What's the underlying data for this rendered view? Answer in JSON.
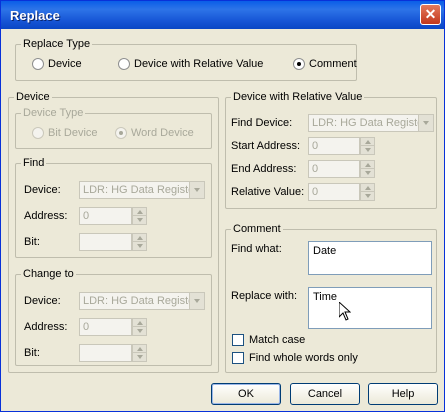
{
  "window": {
    "title": "Replace",
    "close_glyph": "✕"
  },
  "replace_type": {
    "legend": "Replace Type",
    "options": [
      {
        "label": "Device",
        "selected": false
      },
      {
        "label": "Device with Relative Value",
        "selected": false
      },
      {
        "label": "Comment",
        "selected": true
      }
    ]
  },
  "device": {
    "legend": "Device",
    "device_type": {
      "legend": "Device Type",
      "options": [
        {
          "label": "Bit Device",
          "selected": false
        },
        {
          "label": "Word Device",
          "selected": true
        }
      ]
    },
    "find": {
      "legend": "Find",
      "device_label": "Device:",
      "device_value": "LDR: HG Data Register",
      "address_label": "Address:",
      "address_value": "0",
      "bit_label": "Bit:",
      "bit_value": ""
    },
    "change_to": {
      "legend": "Change to",
      "device_label": "Device:",
      "device_value": "LDR: HG Data Register",
      "address_label": "Address:",
      "address_value": "0",
      "bit_label": "Bit:",
      "bit_value": ""
    }
  },
  "relative": {
    "legend": "Device with Relative Value",
    "find_device_label": "Find Device:",
    "find_device_value": "LDR: HG Data Register",
    "start_address_label": "Start Address:",
    "start_address_value": "0",
    "end_address_label": "End Address:",
    "end_address_value": "0",
    "relative_value_label": "Relative Value:",
    "relative_value_value": "0"
  },
  "comment": {
    "legend": "Comment",
    "find_what_label": "Find what:",
    "find_what_value": "Date",
    "replace_with_label": "Replace with:",
    "replace_with_value": "Time",
    "match_case_label": "Match case",
    "match_case_checked": false,
    "whole_words_label": "Find whole words only",
    "whole_words_checked": false
  },
  "buttons": {
    "ok": "OK",
    "cancel": "Cancel",
    "help": "Help"
  },
  "colors": {
    "titlebar": "#0a5ee8",
    "dialog_bg": "#ece9d8",
    "disabled_text": "#a8a89a"
  }
}
